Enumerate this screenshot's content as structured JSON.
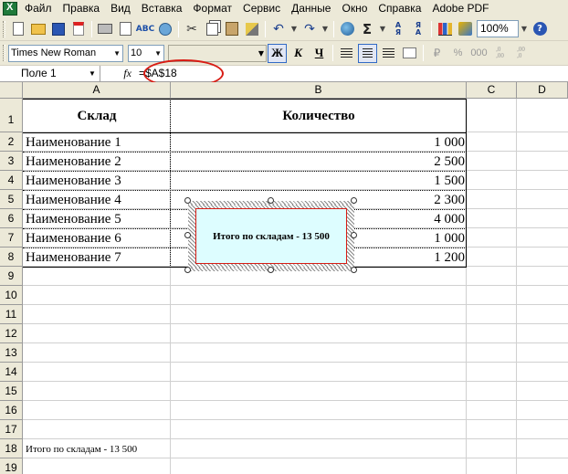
{
  "menu": {
    "items": [
      "Файл",
      "Правка",
      "Вид",
      "Вставка",
      "Формат",
      "Сервис",
      "Данные",
      "Окно",
      "Справка",
      "Adobe PDF"
    ]
  },
  "toolbar": {
    "zoom": "100%"
  },
  "format_toolbar": {
    "font_name": "Times New Roman",
    "font_size": "10",
    "bold_label": "Ж",
    "italic_label": "К",
    "underline_label": "Ч",
    "percent_label": "%",
    "thousands_label": "000"
  },
  "formula_bar": {
    "name_box": "Поле 1",
    "fx_label": "fx",
    "formula": "=$A$18"
  },
  "sheet": {
    "columns": [
      "A",
      "B",
      "C",
      "D"
    ],
    "rows": [
      "1",
      "2",
      "3",
      "4",
      "5",
      "6",
      "7",
      "8",
      "9",
      "10",
      "11",
      "12",
      "13",
      "14",
      "15",
      "16",
      "17",
      "18",
      "19"
    ],
    "header": {
      "col_a": "Склад",
      "col_b": "Количество"
    },
    "data_rows": [
      {
        "name": "Наименование 1",
        "qty": "1 000"
      },
      {
        "name": "Наименование 2",
        "qty": "2 500"
      },
      {
        "name": "Наименование 3",
        "qty": "1 500"
      },
      {
        "name": "Наименование 4",
        "qty": "2 300"
      },
      {
        "name": "Наименование 5",
        "qty": "4 000"
      },
      {
        "name": "Наименование 6",
        "qty": "1 000"
      },
      {
        "name": "Наименование 7",
        "qty": "1 200"
      }
    ],
    "a18": "Итого по складам - 13 500"
  },
  "textbox": {
    "text": "Итого по складам - 13 500",
    "fill_color": "#ddfdff",
    "border_color": "#d81c14"
  },
  "annotation": {
    "highlight_color": "#d81c14"
  }
}
